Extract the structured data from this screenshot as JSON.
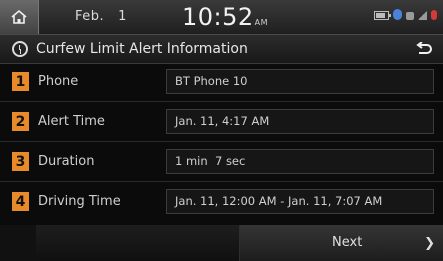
{
  "status_bar": {
    "month": "Feb.",
    "day": "1",
    "time": "10:52",
    "ampm": "AM",
    "icons": [
      "battery-icon",
      "bluetooth-icon",
      "phone-icon",
      "signal-icon",
      "mic-icon"
    ]
  },
  "title_bar": {
    "title": "Curfew Limit Alert Information",
    "icon": "alarm-clock-icon",
    "back_icon": "back-arrow-icon"
  },
  "rows": [
    {
      "number": "1",
      "label": "Phone",
      "value": "BT Phone 10"
    },
    {
      "number": "2",
      "label": "Alert Time",
      "value": "Jan. 11, 4:17 AM"
    },
    {
      "number": "3",
      "label": "Duration",
      "value": "1 min  7 sec"
    },
    {
      "number": "4",
      "label": "Driving Time",
      "value": "Jan. 11, 12:00 AM - Jan. 11, 7:07 AM"
    }
  ],
  "bottom_bar": {
    "next_label": "Next",
    "next_icon": "chevron-right-icon"
  },
  "colors": {
    "badge": "#e8892a",
    "bluetooth": "#4a82d8",
    "mic": "#d43a3a"
  }
}
